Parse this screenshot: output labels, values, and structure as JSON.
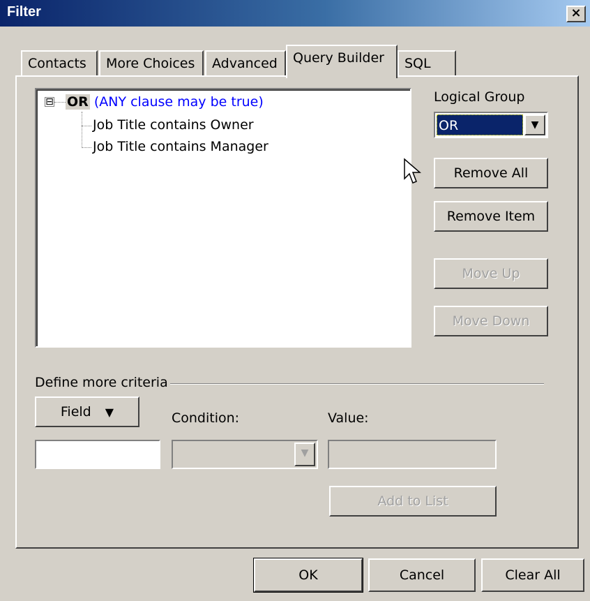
{
  "window": {
    "title": "Filter",
    "close_label": "×"
  },
  "tabs": [
    {
      "label": "Contacts"
    },
    {
      "label": "More Choices"
    },
    {
      "label": "Advanced"
    },
    {
      "label": "Query Builder",
      "active": true
    },
    {
      "label": "SQL"
    }
  ],
  "tree": {
    "expander": "⊟",
    "root_label": "OR",
    "root_desc": "(ANY clause may be true)",
    "items": [
      {
        "label": "Job Title contains Owner"
      },
      {
        "label": "Job Title contains Manager"
      }
    ]
  },
  "logical_group": {
    "label": "Logical Group",
    "selected": "OR"
  },
  "side_buttons": {
    "remove_all": "Remove All",
    "remove_item": "Remove Item",
    "move_up": "Move Up",
    "move_down": "Move Down"
  },
  "criteria": {
    "group_label": "Define more criteria",
    "field_button": "Field",
    "condition_label": "Condition:",
    "value_label": "Value:",
    "add_to_list": "Add to List"
  },
  "footer": {
    "ok": "OK",
    "cancel": "Cancel",
    "clear_all": "Clear All"
  },
  "icons": {
    "cursor": "arrow-cursor-icon",
    "dropdown": "triangle-down-icon",
    "close": "close-icon",
    "expander": "tree-collapse-icon"
  }
}
